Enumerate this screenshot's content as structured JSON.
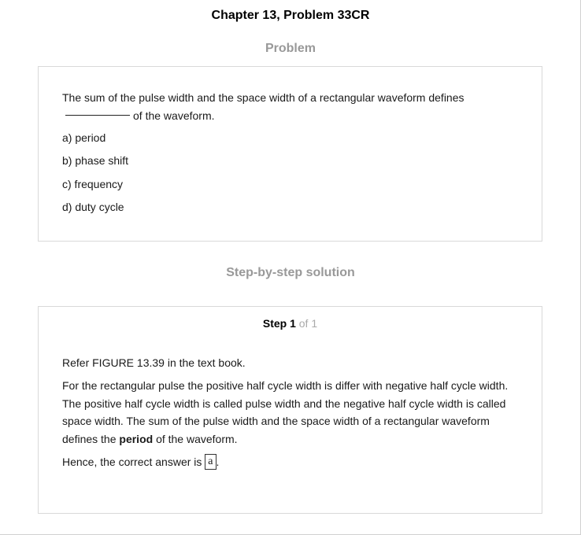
{
  "header": {
    "title": "Chapter 13, Problem 33CR"
  },
  "problem": {
    "heading": "Problem",
    "question_part1": "The sum of the pulse width and the space width of a rectangular waveform defines",
    "question_part2": "of the waveform.",
    "options": [
      {
        "label": "a) period"
      },
      {
        "label": "b) phase shift"
      },
      {
        "label": "c) frequency"
      },
      {
        "label": "d) duty cycle"
      }
    ]
  },
  "solution": {
    "heading": "Step-by-step solution",
    "step_label": "Step 1",
    "step_total": "of 1",
    "paragraph1": "Refer FIGURE 13.39 in the text book.",
    "paragraph2_part1": "For the rectangular pulse the positive half cycle width is differ with negative half cycle width. The positive half cycle width is called pulse width and the negative half cycle width is called space width. The sum of the pulse width and the space width of a rectangular waveform defines the",
    "paragraph2_bold": "period",
    "paragraph2_part2": "of the waveform.",
    "answer_prefix": "Hence, the correct answer is",
    "answer_value": "a",
    "answer_suffix": "."
  }
}
